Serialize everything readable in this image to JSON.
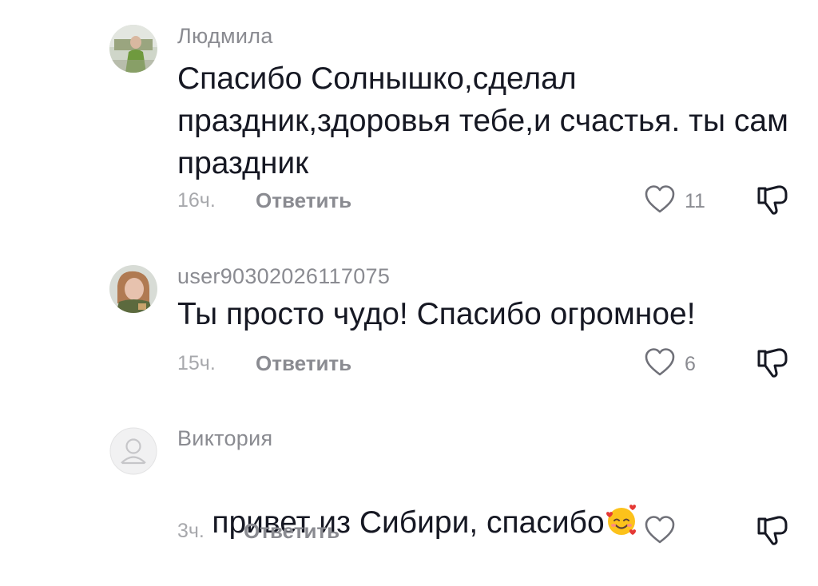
{
  "comments": [
    {
      "username": "Людмила",
      "text": "Спасибо Солнышко,сделал праздник,здоровья тебе,и счастья. ты сам праздник",
      "time": "16ч.",
      "reply_label": "Ответить",
      "like_count": "11",
      "avatar_icon": "user-photo-avatar"
    },
    {
      "username": "user90302026117075",
      "text": "Ты просто чудо! Спасибо огромное!",
      "time": "15ч.",
      "reply_label": "Ответить",
      "like_count": "6",
      "avatar_icon": "user-photo-avatar"
    },
    {
      "username": "Виктория",
      "text": "привет из Сибири, спасибо",
      "time": "3ч.",
      "reply_label": "Ответить",
      "like_count": "",
      "avatar_icon": "default-user-avatar",
      "emoji": "smiling-face-with-hearts-emoji"
    }
  ],
  "colors": {
    "text": "#161823",
    "secondary": "#8a8b91",
    "time": "#a7a8ac",
    "icon_stroke": "#6f7078"
  },
  "icons": [
    "heart-outline-icon",
    "dislike-icon"
  ]
}
